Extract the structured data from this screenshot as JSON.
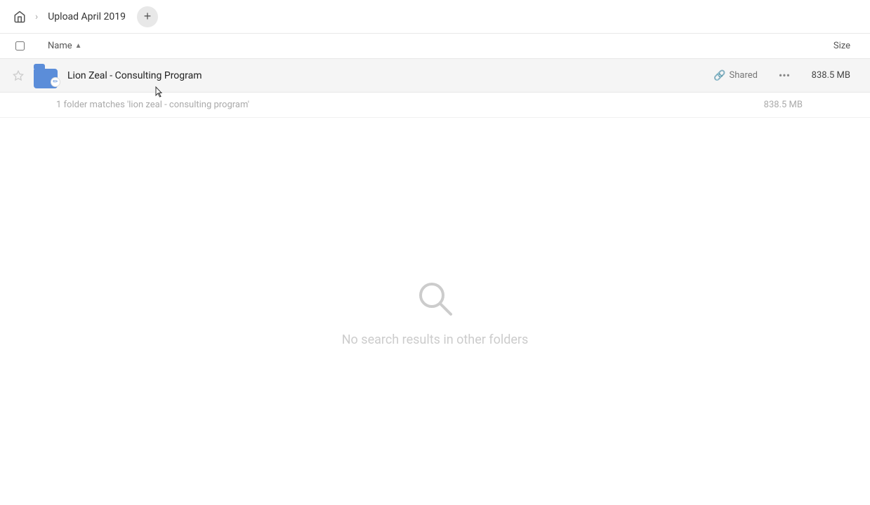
{
  "header": {
    "home_icon": "home",
    "breadcrumb": [
      {
        "label": "Upload April 2019"
      }
    ],
    "add_tab_label": "+"
  },
  "columns": {
    "name_label": "Name",
    "sort_arrow": "▲",
    "size_label": "Size"
  },
  "file_row": {
    "name": "Lion Zeal - Consulting Program",
    "shared_label": "Shared",
    "size": "838.5 MB"
  },
  "match_info": {
    "text": "1 folder matches 'lion zeal - consulting program'",
    "size": "838.5 MB"
  },
  "empty_state": {
    "message": "No search results in other folders"
  }
}
